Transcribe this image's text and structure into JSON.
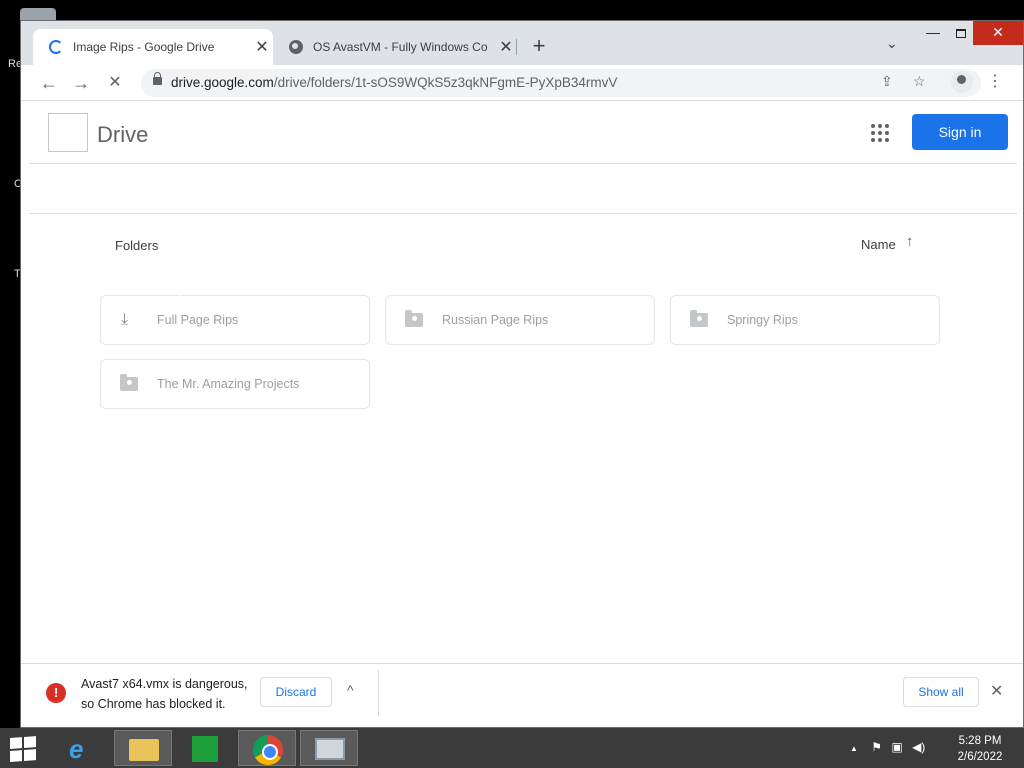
{
  "desktop": {
    "icon_labels": [
      "Re",
      "C",
      "T"
    ]
  },
  "browser": {
    "tabs": [
      {
        "title": "Image Rips - Google Drive",
        "close": "✕"
      },
      {
        "title": "OS AvastVM - Fully Windows Co",
        "close": "✕"
      }
    ],
    "new_tab": "+",
    "tab_menu": "⌄",
    "window_controls": {
      "minimize": "—",
      "close": "✕"
    },
    "nav": {
      "back": "←",
      "forward": "→",
      "stop": "✕"
    },
    "url_host": "drive.google.com",
    "url_path": "/drive/folders/1t-sOS9WQkS5z3qkNFgmE-PyXpB34rmvV",
    "kebab": "⋮"
  },
  "drive": {
    "title": "Drive",
    "signin_label": "Sign in",
    "folders_label": "Folders",
    "sort_label": "Name",
    "sort_arrow": "↑",
    "folders": [
      {
        "name": "Full Page Rips",
        "icon": "download-icon"
      },
      {
        "name": "Russian Page Rips",
        "icon": "shared-folder-icon"
      },
      {
        "name": "Springy Rips",
        "icon": "shared-folder-icon"
      },
      {
        "name": "The Mr. Amazing Projects",
        "icon": "shared-folder-icon"
      }
    ]
  },
  "download_bar": {
    "warning_icon": "!",
    "message_line1": "Avast7 x64.vmx is dangerous,",
    "message_line2": "so Chrome has blocked it.",
    "discard_label": "Discard",
    "caret": "^",
    "show_all_label": "Show all",
    "close": "✕"
  },
  "taskbar": {
    "ie_glyph": "e",
    "time": "5:28 PM",
    "date": "2/6/2022",
    "tray_arrow": "▲"
  },
  "colors": {
    "accent": "#1a73e8",
    "danger": "#d93025"
  }
}
